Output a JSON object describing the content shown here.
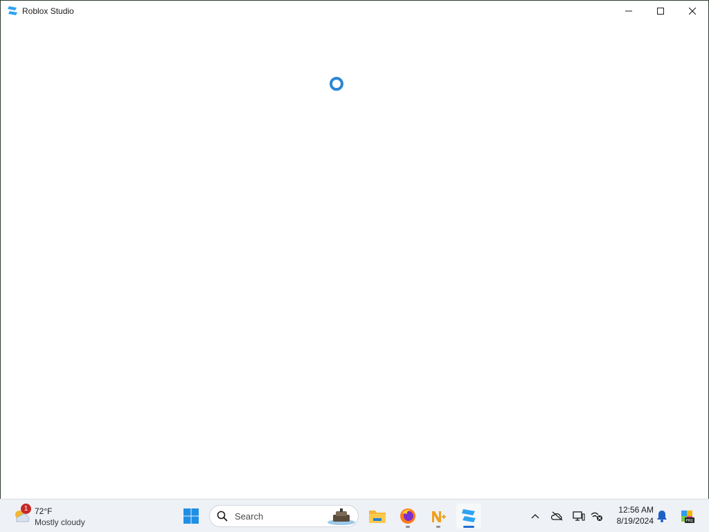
{
  "window": {
    "title": "Roblox Studio",
    "controls": {
      "minimize": "minimize",
      "maximize": "maximize",
      "close": "close"
    }
  },
  "content": {
    "state": "loading",
    "spinner_color": "#2a86d4"
  },
  "taskbar": {
    "weather": {
      "badge": "1",
      "temperature": "72°F",
      "condition": "Mostly cloudy",
      "icon": "partly-cloudy-icon"
    },
    "search": {
      "placeholder": "Search"
    },
    "pinned_apps": [
      {
        "name": "File Explorer",
        "icon": "folder-icon",
        "running": false
      },
      {
        "name": "Firefox",
        "icon": "firefox-icon",
        "running": true
      },
      {
        "name": "Notepad++",
        "icon": "notepad-plus-icon",
        "running": true
      },
      {
        "name": "Roblox Studio",
        "icon": "roblox-studio-icon",
        "running": true,
        "active": true
      }
    ],
    "tray": {
      "icons": [
        "chevron-up-icon",
        "onedrive-offline-icon",
        "display-icon",
        "network-disconnected-icon"
      ],
      "time": "12:56 AM",
      "date": "8/19/2024",
      "extra_icons": [
        "notification-bell-icon",
        "copilot-pre-icon"
      ]
    }
  },
  "colors": {
    "accent": "#1f6fd1",
    "badge": "#c62828",
    "roblox_icon": "#2ea3f2"
  }
}
